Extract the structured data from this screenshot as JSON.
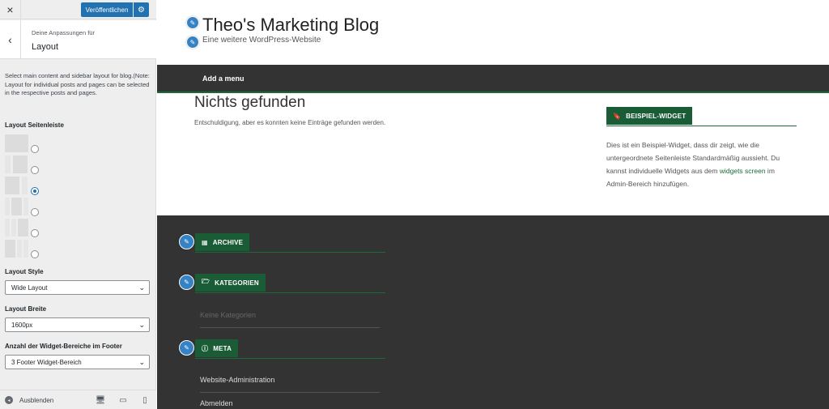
{
  "customizer": {
    "close_icon": "×",
    "publish_label": "Veröffentlichen",
    "gear_icon": "⚙",
    "back_icon": "‹",
    "section_subtitle": "Deine Anpassungen für",
    "section_title": "Layout",
    "description": "Select main content and sidebar layout for blog.(Note: Layout for individual posts and pages can be selected in the respective posts and pages.",
    "sidebar_layout_label": "Layout Seitenleiste",
    "sidebar_layout_selected_index": 2,
    "layout_style": {
      "label": "Layout Style",
      "value": "Wide Layout"
    },
    "layout_width": {
      "label": "Layout Breite",
      "value": "1600px"
    },
    "footer_widgets": {
      "label": "Anzahl der Widget-Bereiche im Footer",
      "value": "3 Footer Widget-Bereich"
    },
    "select_chevron": "⌄",
    "hide_label": "Ausblenden",
    "hide_icon": "◂",
    "device_icons": {
      "desktop": "🖥",
      "tablet": "▭",
      "mobile": "▯"
    }
  },
  "site": {
    "title": "Theo's Marketing Blog",
    "tagline": "Eine weitere WordPress-Website",
    "pencil_icon": "✎",
    "nav_add_menu": "Add a menu",
    "not_found_title": "Nichts gefunden",
    "not_found_text": "Entschuldigung, aber es konnten keine Einträge gefunden werden.",
    "sidebar_widget": {
      "title": "Beispiel-Widget",
      "icon": "🔖",
      "text_before": "Dies ist ein Beispiel-Widget, dass dir zeigt, wie die untergeordnete Seitenleiste Standardmäßig aussieht. Du kannst individuelle Widgets aus dem ",
      "link": "widgets screen",
      "text_after": " im Admin-Bereich hinzufügen."
    },
    "footer": {
      "archive_title": "Archive",
      "archive_icon": "▦",
      "categories_title": "Kategorien",
      "categories_icon": "🗁",
      "categories_empty": "Keine Kategorien",
      "meta_title": "Meta",
      "meta_icon": "ⓘ",
      "meta_items": [
        "Website-Administration",
        "Abmelden"
      ]
    }
  },
  "colors": {
    "accent_blue": "#2271b1",
    "widget_green": "#1a5c36",
    "dark_bar": "#333333"
  }
}
